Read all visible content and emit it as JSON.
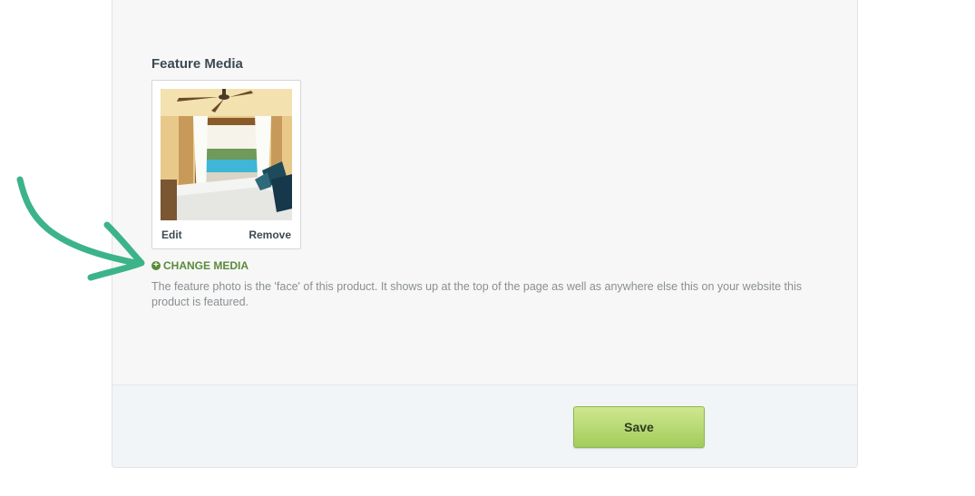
{
  "feature_media": {
    "title": "Feature Media",
    "edit_label": "Edit",
    "remove_label": "Remove",
    "change_media_label": "CHANGE MEDIA",
    "help_text": "The feature photo is the 'face' of this product. It shows up at the top of the page as well as anywhere else this on your website this product is featured."
  },
  "footer": {
    "save_label": "Save"
  },
  "icons": {
    "change_media": "plus-circle-icon",
    "annotation": "curved-arrow-icon"
  },
  "colors": {
    "accent_green": "#5a8a3a",
    "save_button": "#a3cc5c",
    "arrow": "#3db38a"
  }
}
